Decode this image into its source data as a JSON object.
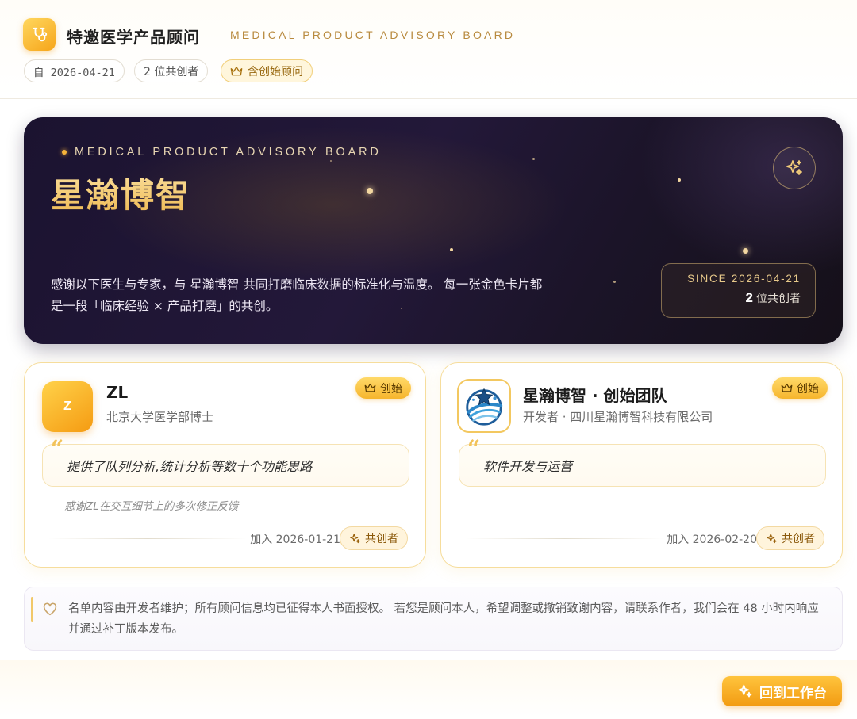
{
  "header": {
    "icon": "stethoscope-icon",
    "title": "特邀医学产品顾问",
    "subtitle": "MEDICAL PRODUCT ADVISORY BOARD",
    "chips": {
      "since": "自 2026-04-21",
      "count": "2 位共创者",
      "founder": "含创始顾问"
    }
  },
  "hero": {
    "eyebrow": "MEDICAL PRODUCT ADVISORY BOARD",
    "title": "星瀚博智",
    "description": "感谢以下医生与专家，与 星瀚博智 共同打磨临床数据的标准化与温度。 每一张金色卡片都是一段「临床经验 × 产品打磨」的共创。",
    "since_label": "SINCE 2026-04-21",
    "count_number": "2",
    "count_suffix": "位共创者",
    "spark_icon": "sparkles-icon"
  },
  "advisors": [
    {
      "avatar_text": "Z",
      "name": "ZL",
      "role": "北京大学医学部博士",
      "badge": "创始",
      "quote_mark": "“",
      "quote": "提供了队列分析,统计分析等数十个功能思路",
      "note": "——感谢ZL在交互细节上的多次修正反馈",
      "joined": "加入 2026-01-21",
      "tag": "共创者"
    },
    {
      "avatar_icon": "company-logo-icon",
      "name": "星瀚博智 · 创始团队",
      "role": "开发者 · 四川星瀚博智科技有限公司",
      "badge": "创始",
      "quote_mark": "“",
      "quote": "软件开发与运营",
      "note": "",
      "joined": "加入 2026-02-20",
      "tag": "共创者"
    }
  ],
  "notice": {
    "icon": "heart-icon",
    "text": "名单内容由开发者维护；所有顾问信息均已征得本人书面授权。 若您是顾问本人，希望调整或撤销致谢内容，请联系作者，我们会在 48 小时内响应并通过补丁版本发布。"
  },
  "footer": {
    "back_label": "回到工作台",
    "back_icon": "sparkles-icon"
  },
  "colors": {
    "accent": "#f5a623",
    "gold_text": "#b88a3e",
    "hero_bg": "#1d1530"
  }
}
